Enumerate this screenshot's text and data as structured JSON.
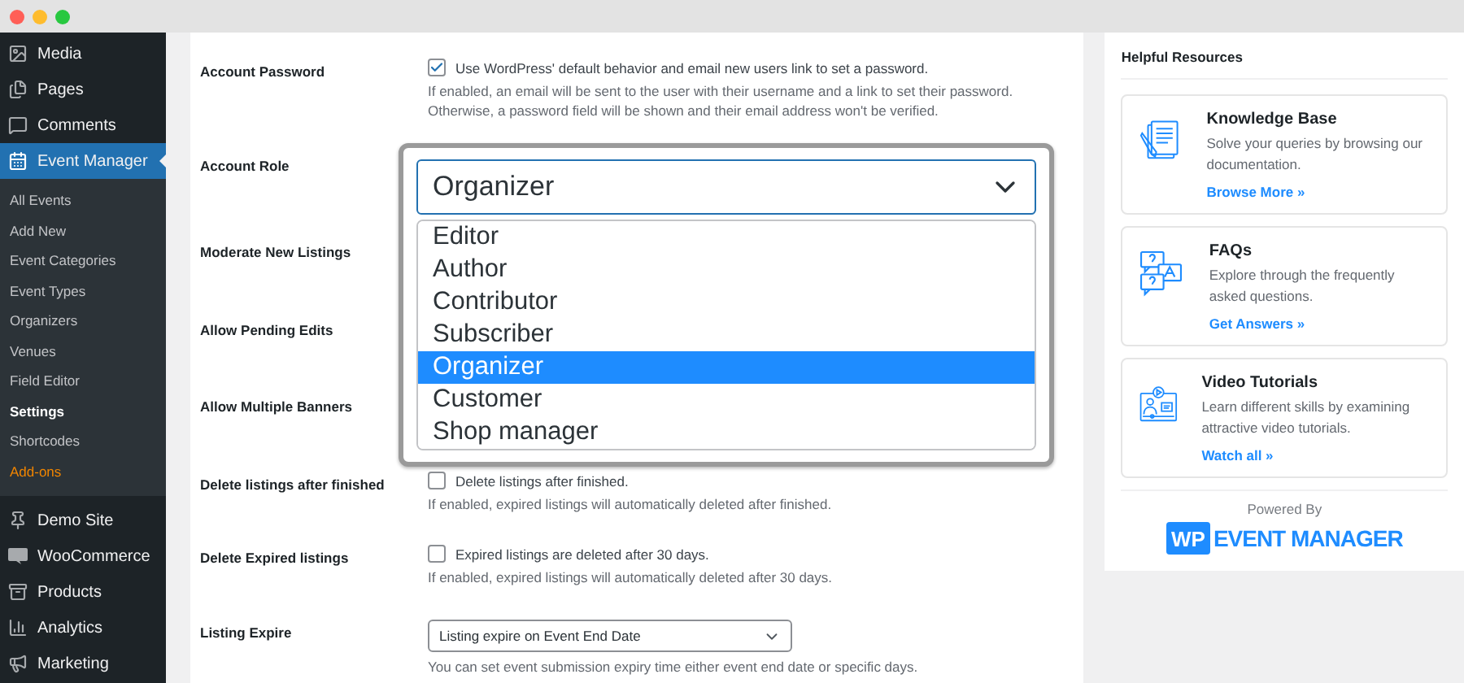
{
  "sidebar": {
    "items": [
      {
        "label": "Media",
        "selected": false
      },
      {
        "label": "Pages",
        "selected": false
      },
      {
        "label": "Comments",
        "selected": false
      },
      {
        "label": "Event Manager",
        "selected": true,
        "children": [
          {
            "label": "All Events",
            "kind": "link",
            "selected": false
          },
          {
            "label": "Add New",
            "kind": "link",
            "selected": false
          },
          {
            "label": "Event Categories",
            "kind": "link",
            "selected": false
          },
          {
            "label": "Event Types",
            "kind": "link",
            "selected": false
          },
          {
            "label": "Organizers",
            "kind": "link",
            "selected": false
          },
          {
            "label": "Venues",
            "kind": "link",
            "selected": false
          },
          {
            "label": "Field Editor",
            "kind": "link",
            "selected": false
          },
          {
            "label": "Settings",
            "kind": "link",
            "selected": true
          },
          {
            "label": "Shortcodes",
            "kind": "link",
            "selected": false
          },
          {
            "label": "Add-ons",
            "kind": "addon",
            "selected": false
          }
        ]
      },
      {
        "label": "Demo Site",
        "selected": false
      },
      {
        "label": "WooCommerce",
        "selected": false
      },
      {
        "label": "Products",
        "selected": false
      },
      {
        "label": "Analytics",
        "selected": false
      },
      {
        "label": "Marketing",
        "selected": false
      }
    ]
  },
  "settings": [
    {
      "label": "Account Password",
      "kind": "checkbox",
      "checked": true,
      "option": "Use WordPress' default behavior and email new users link to set a password.",
      "description": "If enabled, an email will be sent to the user with their username and a link to set their password. Otherwise, a password field will be shown and their email address won't be verified."
    },
    {
      "label": "Account Role",
      "kind": "hidden"
    },
    {
      "label": "Moderate New Listings",
      "kind": "hidden"
    },
    {
      "label": "Allow Pending Edits",
      "kind": "hidden"
    },
    {
      "label": "Allow Multiple Banners",
      "kind": "hidden"
    },
    {
      "label": "Delete listings after finished",
      "kind": "checkbox",
      "checked": false,
      "option": "Delete listings after finished.",
      "description": "If enabled, expired listings will automatically deleted after finished."
    },
    {
      "label": "Delete Expired listings",
      "kind": "checkbox",
      "checked": false,
      "option": "Expired listings are deleted after 30 days.",
      "description": "If enabled, expired listings will automatically deleted after 30 days."
    },
    {
      "label": "Listing Expire",
      "kind": "select",
      "value": "Listing expire on Event End Date",
      "description": "You can set event submission expiry time either event end date or specific days."
    }
  ],
  "role_dropdown": {
    "value": "Organizer",
    "options": [
      {
        "label": "Editor",
        "selected": false
      },
      {
        "label": "Author",
        "selected": false
      },
      {
        "label": "Contributor",
        "selected": false
      },
      {
        "label": "Subscriber",
        "selected": false
      },
      {
        "label": "Organizer",
        "selected": true
      },
      {
        "label": "Customer",
        "selected": false
      },
      {
        "label": "Shop manager",
        "selected": false
      }
    ]
  },
  "resources": {
    "title": "Helpful Resources",
    "cards": [
      {
        "title": "Knowledge Base",
        "text": "Solve your queries by browsing our documentation.",
        "link": "Browse More »"
      },
      {
        "title": "FAQs",
        "text": "Explore through the frequently asked questions.",
        "link": "Get Answers »"
      },
      {
        "title": "Video Tutorials",
        "text": "Learn different skills by examining attractive video tutorials.",
        "link": "Watch all »"
      }
    ],
    "powered_by": "Powered By",
    "logo_badge": "WP",
    "logo_text": "EVENT MANAGER"
  }
}
